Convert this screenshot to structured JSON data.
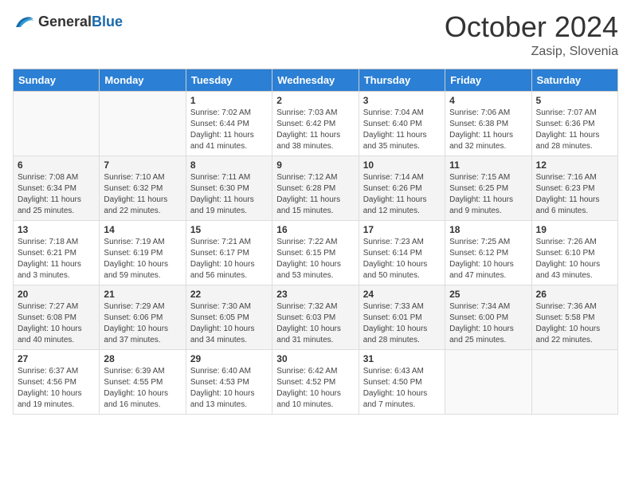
{
  "header": {
    "logo_general": "General",
    "logo_blue": "Blue",
    "month": "October 2024",
    "location": "Zasip, Slovenia"
  },
  "days_of_week": [
    "Sunday",
    "Monday",
    "Tuesday",
    "Wednesday",
    "Thursday",
    "Friday",
    "Saturday"
  ],
  "weeks": [
    [
      {
        "day": "",
        "sunrise": "",
        "sunset": "",
        "daylight": ""
      },
      {
        "day": "",
        "sunrise": "",
        "sunset": "",
        "daylight": ""
      },
      {
        "day": "1",
        "sunrise": "Sunrise: 7:02 AM",
        "sunset": "Sunset: 6:44 PM",
        "daylight": "Daylight: 11 hours and 41 minutes."
      },
      {
        "day": "2",
        "sunrise": "Sunrise: 7:03 AM",
        "sunset": "Sunset: 6:42 PM",
        "daylight": "Daylight: 11 hours and 38 minutes."
      },
      {
        "day": "3",
        "sunrise": "Sunrise: 7:04 AM",
        "sunset": "Sunset: 6:40 PM",
        "daylight": "Daylight: 11 hours and 35 minutes."
      },
      {
        "day": "4",
        "sunrise": "Sunrise: 7:06 AM",
        "sunset": "Sunset: 6:38 PM",
        "daylight": "Daylight: 11 hours and 32 minutes."
      },
      {
        "day": "5",
        "sunrise": "Sunrise: 7:07 AM",
        "sunset": "Sunset: 6:36 PM",
        "daylight": "Daylight: 11 hours and 28 minutes."
      }
    ],
    [
      {
        "day": "6",
        "sunrise": "Sunrise: 7:08 AM",
        "sunset": "Sunset: 6:34 PM",
        "daylight": "Daylight: 11 hours and 25 minutes."
      },
      {
        "day": "7",
        "sunrise": "Sunrise: 7:10 AM",
        "sunset": "Sunset: 6:32 PM",
        "daylight": "Daylight: 11 hours and 22 minutes."
      },
      {
        "day": "8",
        "sunrise": "Sunrise: 7:11 AM",
        "sunset": "Sunset: 6:30 PM",
        "daylight": "Daylight: 11 hours and 19 minutes."
      },
      {
        "day": "9",
        "sunrise": "Sunrise: 7:12 AM",
        "sunset": "Sunset: 6:28 PM",
        "daylight": "Daylight: 11 hours and 15 minutes."
      },
      {
        "day": "10",
        "sunrise": "Sunrise: 7:14 AM",
        "sunset": "Sunset: 6:26 PM",
        "daylight": "Daylight: 11 hours and 12 minutes."
      },
      {
        "day": "11",
        "sunrise": "Sunrise: 7:15 AM",
        "sunset": "Sunset: 6:25 PM",
        "daylight": "Daylight: 11 hours and 9 minutes."
      },
      {
        "day": "12",
        "sunrise": "Sunrise: 7:16 AM",
        "sunset": "Sunset: 6:23 PM",
        "daylight": "Daylight: 11 hours and 6 minutes."
      }
    ],
    [
      {
        "day": "13",
        "sunrise": "Sunrise: 7:18 AM",
        "sunset": "Sunset: 6:21 PM",
        "daylight": "Daylight: 11 hours and 3 minutes."
      },
      {
        "day": "14",
        "sunrise": "Sunrise: 7:19 AM",
        "sunset": "Sunset: 6:19 PM",
        "daylight": "Daylight: 10 hours and 59 minutes."
      },
      {
        "day": "15",
        "sunrise": "Sunrise: 7:21 AM",
        "sunset": "Sunset: 6:17 PM",
        "daylight": "Daylight: 10 hours and 56 minutes."
      },
      {
        "day": "16",
        "sunrise": "Sunrise: 7:22 AM",
        "sunset": "Sunset: 6:15 PM",
        "daylight": "Daylight: 10 hours and 53 minutes."
      },
      {
        "day": "17",
        "sunrise": "Sunrise: 7:23 AM",
        "sunset": "Sunset: 6:14 PM",
        "daylight": "Daylight: 10 hours and 50 minutes."
      },
      {
        "day": "18",
        "sunrise": "Sunrise: 7:25 AM",
        "sunset": "Sunset: 6:12 PM",
        "daylight": "Daylight: 10 hours and 47 minutes."
      },
      {
        "day": "19",
        "sunrise": "Sunrise: 7:26 AM",
        "sunset": "Sunset: 6:10 PM",
        "daylight": "Daylight: 10 hours and 43 minutes."
      }
    ],
    [
      {
        "day": "20",
        "sunrise": "Sunrise: 7:27 AM",
        "sunset": "Sunset: 6:08 PM",
        "daylight": "Daylight: 10 hours and 40 minutes."
      },
      {
        "day": "21",
        "sunrise": "Sunrise: 7:29 AM",
        "sunset": "Sunset: 6:06 PM",
        "daylight": "Daylight: 10 hours and 37 minutes."
      },
      {
        "day": "22",
        "sunrise": "Sunrise: 7:30 AM",
        "sunset": "Sunset: 6:05 PM",
        "daylight": "Daylight: 10 hours and 34 minutes."
      },
      {
        "day": "23",
        "sunrise": "Sunrise: 7:32 AM",
        "sunset": "Sunset: 6:03 PM",
        "daylight": "Daylight: 10 hours and 31 minutes."
      },
      {
        "day": "24",
        "sunrise": "Sunrise: 7:33 AM",
        "sunset": "Sunset: 6:01 PM",
        "daylight": "Daylight: 10 hours and 28 minutes."
      },
      {
        "day": "25",
        "sunrise": "Sunrise: 7:34 AM",
        "sunset": "Sunset: 6:00 PM",
        "daylight": "Daylight: 10 hours and 25 minutes."
      },
      {
        "day": "26",
        "sunrise": "Sunrise: 7:36 AM",
        "sunset": "Sunset: 5:58 PM",
        "daylight": "Daylight: 10 hours and 22 minutes."
      }
    ],
    [
      {
        "day": "27",
        "sunrise": "Sunrise: 6:37 AM",
        "sunset": "Sunset: 4:56 PM",
        "daylight": "Daylight: 10 hours and 19 minutes."
      },
      {
        "day": "28",
        "sunrise": "Sunrise: 6:39 AM",
        "sunset": "Sunset: 4:55 PM",
        "daylight": "Daylight: 10 hours and 16 minutes."
      },
      {
        "day": "29",
        "sunrise": "Sunrise: 6:40 AM",
        "sunset": "Sunset: 4:53 PM",
        "daylight": "Daylight: 10 hours and 13 minutes."
      },
      {
        "day": "30",
        "sunrise": "Sunrise: 6:42 AM",
        "sunset": "Sunset: 4:52 PM",
        "daylight": "Daylight: 10 hours and 10 minutes."
      },
      {
        "day": "31",
        "sunrise": "Sunrise: 6:43 AM",
        "sunset": "Sunset: 4:50 PM",
        "daylight": "Daylight: 10 hours and 7 minutes."
      },
      {
        "day": "",
        "sunrise": "",
        "sunset": "",
        "daylight": ""
      },
      {
        "day": "",
        "sunrise": "",
        "sunset": "",
        "daylight": ""
      }
    ]
  ]
}
